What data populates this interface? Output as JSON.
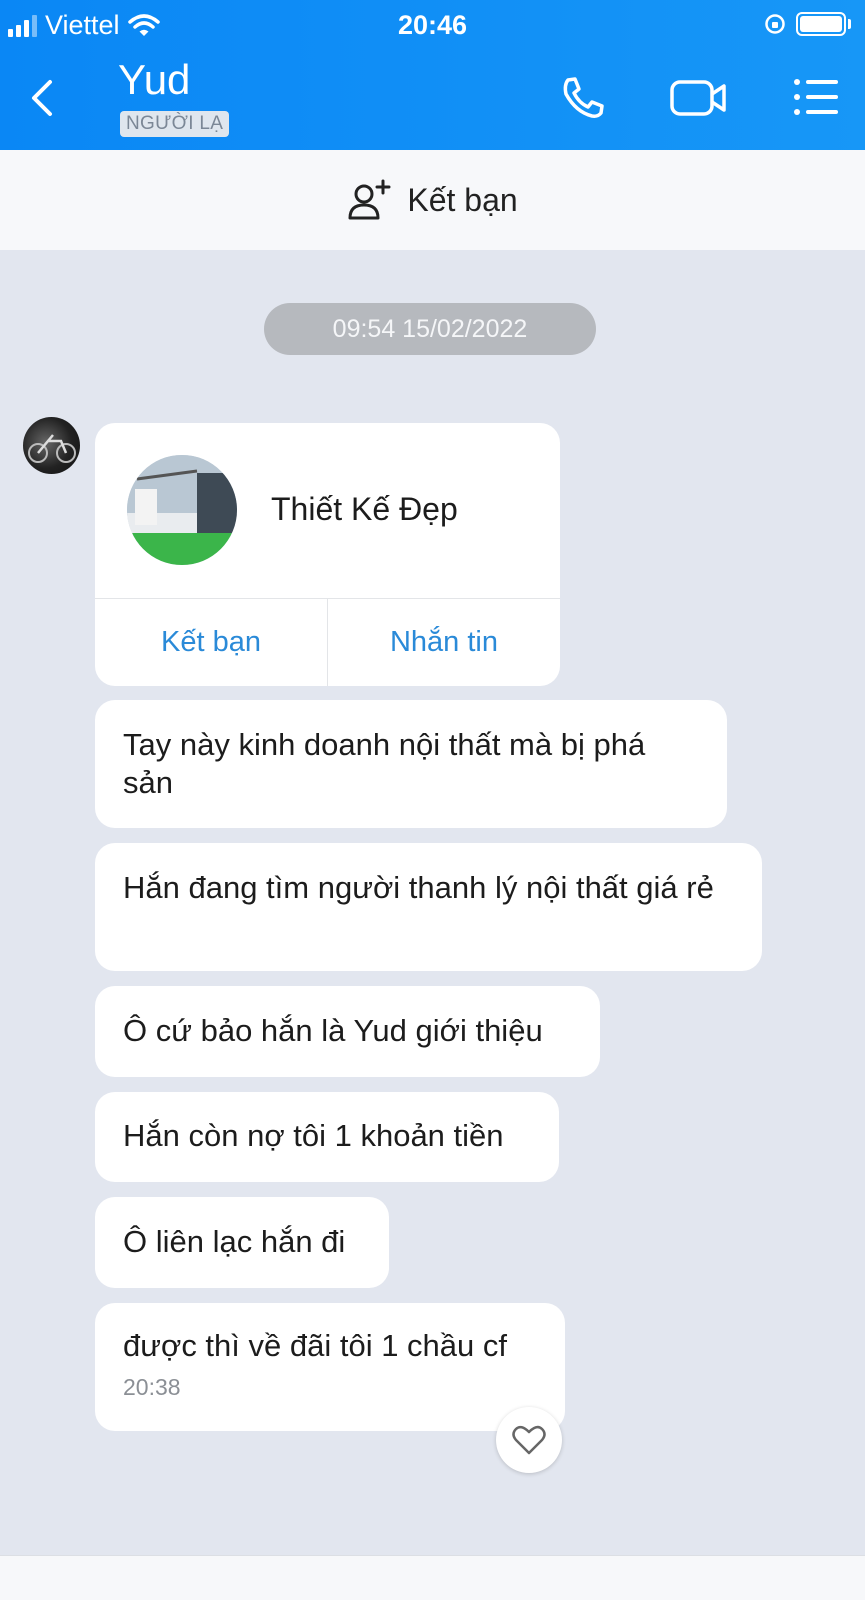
{
  "status_bar": {
    "carrier": "Viettel",
    "time": "20:46"
  },
  "chat_header": {
    "contact_name": "Yud",
    "badge": "NGƯỜI LẠ"
  },
  "add_friend_bar": {
    "label": "Kết bạn"
  },
  "timestamp_divider": "09:54 15/02/2022",
  "contact_card": {
    "name": "Thiết Kế Đẹp",
    "add_friend_label": "Kết bạn",
    "message_label": "Nhắn tin"
  },
  "messages": [
    {
      "text": "Tay này kinh doanh nội thất mà bị phá sản"
    },
    {
      "text": "Hắn đang tìm người thanh lý nội thất giá rẻ"
    },
    {
      "text": "Ô cứ bảo hắn là Yud giới thiệu"
    },
    {
      "text": "Hắn còn nợ tôi 1 khoản tiền"
    },
    {
      "text": "Ô liên lạc hắn đi"
    },
    {
      "text": "được thì về đãi tôi 1 chầu cf",
      "time": "20:38"
    }
  ],
  "colors": {
    "header": "#0a87f5",
    "link": "#2a8ad8",
    "background": "#e2e6ef"
  }
}
